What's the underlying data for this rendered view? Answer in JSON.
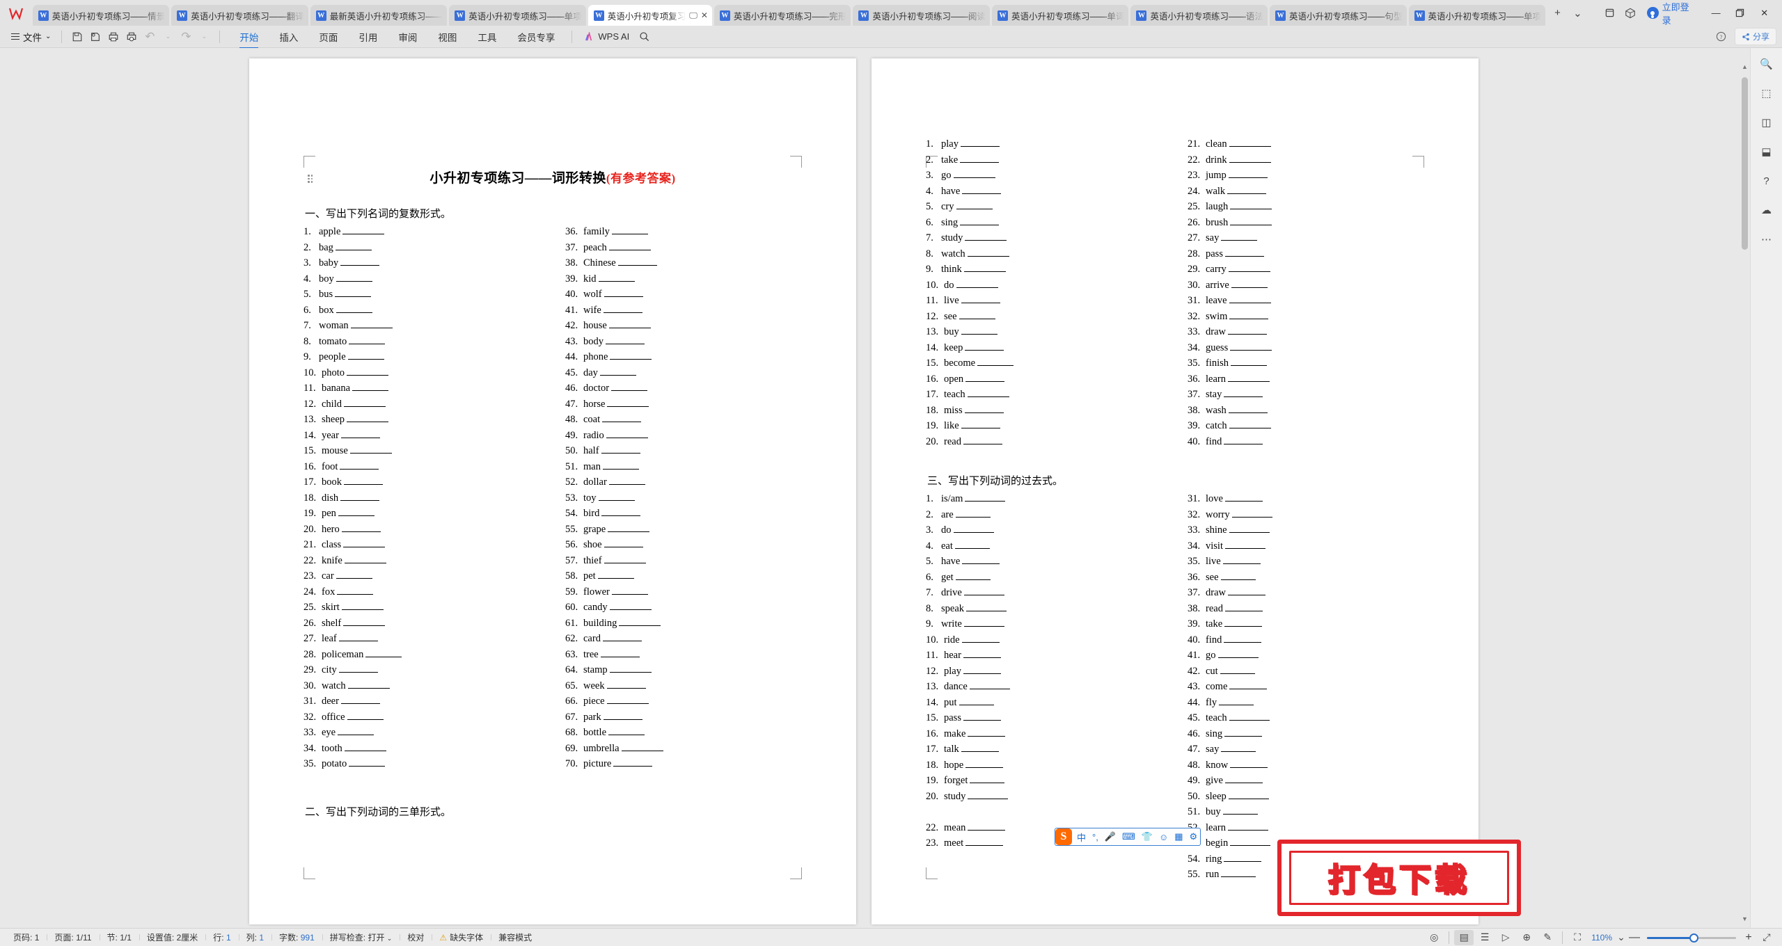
{
  "window": {
    "app_icon": "wps-logo-icon",
    "login_label": "立即登录",
    "minimize": "—",
    "restore": "❐",
    "close": "✕",
    "new_tab": "+",
    "tab_dropdown": "⌄"
  },
  "tabs": [
    {
      "label": "英语小升初专项练习——情景",
      "active": false
    },
    {
      "label": "英语小升初专项练习——翻译",
      "active": false
    },
    {
      "label": "最新英语小升初专项练习——",
      "active": false
    },
    {
      "label": "英语小升初专项练习——单项",
      "active": false
    },
    {
      "label": "英语小升初专项复习",
      "active": true
    },
    {
      "label": "英语小升初专项练习——完形",
      "active": false
    },
    {
      "label": "英语小升初专项练习——阅读",
      "active": false
    },
    {
      "label": "英语小升初专项练习——单词",
      "active": false
    },
    {
      "label": "英语小升初专项练习——语法",
      "active": false
    },
    {
      "label": "英语小升初专项练习——句型",
      "active": false
    },
    {
      "label": "英语小升初专项练习——单项",
      "active": false
    }
  ],
  "ribbon": {
    "file_label": "文件",
    "file_caret": "⌄",
    "quick_access": [
      {
        "name": "save-icon",
        "glyph": "🖫"
      },
      {
        "name": "save-as-icon",
        "glyph": "🗇"
      },
      {
        "name": "print-icon",
        "glyph": "🖨"
      },
      {
        "name": "print-preview-icon",
        "glyph": "🔍"
      },
      {
        "name": "undo-icon",
        "glyph": "↶"
      },
      {
        "name": "undo-dropdown-icon",
        "glyph": "⌄"
      },
      {
        "name": "redo-icon",
        "glyph": "↷"
      },
      {
        "name": "more-dropdown-icon",
        "glyph": "⌄"
      }
    ],
    "tabs": [
      {
        "label": "开始",
        "active": true
      },
      {
        "label": "插入",
        "active": false
      },
      {
        "label": "页面",
        "active": false
      },
      {
        "label": "引用",
        "active": false
      },
      {
        "label": "审阅",
        "active": false
      },
      {
        "label": "视图",
        "active": false
      },
      {
        "label": "工具",
        "active": false
      },
      {
        "label": "会员专享",
        "active": false
      }
    ],
    "wps_ai_label": "WPS AI",
    "search_icon": "search-icon",
    "help_icon": "help-icon",
    "share_label": "分享"
  },
  "document": {
    "title_black": "小升初专项练习——词形转换",
    "title_red": "(有参考答案)",
    "section1_heading": "一、写出下列名词的复数形式。",
    "section2_heading": "二、写出下列动词的三单形式。",
    "section3_heading": "三、写出下列动词的过去式。",
    "nouns_left": [
      "apple",
      "bag",
      "baby",
      "boy",
      "bus",
      "box",
      "woman",
      "tomato",
      "people",
      "photo",
      "banana",
      "child",
      "sheep",
      "year",
      "mouse",
      "foot",
      "book",
      "dish",
      "pen",
      "hero",
      "class",
      "knife",
      "car",
      "fox",
      "skirt",
      "shelf",
      "leaf",
      "policeman",
      "city",
      "watch",
      "deer",
      "office",
      "eye",
      "tooth",
      "potato"
    ],
    "nouns_right": [
      "family",
      "peach",
      "Chinese",
      "kid",
      "wolf",
      "wife",
      "house",
      "body",
      "phone",
      "day",
      "doctor",
      "horse",
      "coat",
      "radio",
      "half",
      "man",
      "dollar",
      "toy",
      "bird",
      "grape",
      "shoe",
      "thief",
      "pet",
      "flower",
      "candy",
      "building",
      "card",
      "tree",
      "stamp",
      "week",
      "piece",
      "park",
      "bottle",
      "umbrella",
      "picture"
    ],
    "third_person_left": [
      "play",
      "take",
      "go",
      "have",
      "cry",
      "sing",
      "study",
      "watch",
      "think",
      "do",
      "live",
      "see",
      "buy",
      "keep",
      "become",
      "open",
      "teach",
      "miss",
      "like",
      "read"
    ],
    "third_person_right": [
      "clean",
      "drink",
      "jump",
      "walk",
      "laugh",
      "brush",
      "say",
      "pass",
      "carry",
      "arrive",
      "leave",
      "swim",
      "draw",
      "guess",
      "finish",
      "learn",
      "stay",
      "wash",
      "catch",
      "find"
    ],
    "past_left": [
      "is/am",
      "are",
      "do",
      "eat",
      "have",
      "get",
      "drive",
      "speak",
      "write",
      "ride",
      "hear",
      "play",
      "dance",
      "put",
      "pass",
      "make",
      "talk",
      "hope",
      "forget",
      "study",
      "",
      "mean",
      "meet"
    ],
    "past_right": [
      "love",
      "worry",
      "shine",
      "visit",
      "live",
      "see",
      "draw",
      "read",
      "take",
      "find",
      "go",
      "cut",
      "come",
      "fly",
      "teach",
      "sing",
      "say",
      "know",
      "give",
      "sleep",
      "buy",
      "learn",
      "begin",
      "ring",
      "run"
    ]
  },
  "ime": {
    "logo": "sogou-icon",
    "items": [
      {
        "name": "chinese-mode-icon",
        "glyph": "中"
      },
      {
        "name": "punctuation-icon",
        "glyph": "°,"
      },
      {
        "name": "voice-input-icon",
        "glyph": "🎤"
      },
      {
        "name": "soft-keyboard-icon",
        "glyph": "⌨"
      },
      {
        "name": "skin-icon",
        "glyph": "👕"
      },
      {
        "name": "emoji-icon",
        "glyph": "☺"
      },
      {
        "name": "toolbox-icon",
        "glyph": "▦"
      },
      {
        "name": "settings-icon",
        "glyph": "⚙"
      }
    ]
  },
  "watermark": {
    "text": "打包下载",
    "border_color": "#e2262c",
    "text_color": "#ffe600"
  },
  "statusbar": {
    "left_items": [
      {
        "label": "页码:",
        "value": "1"
      },
      {
        "label": "页面:",
        "value": "1/11"
      },
      {
        "label": "节:",
        "value": "1/1"
      },
      {
        "label": "设置值:",
        "value": "2厘米"
      },
      {
        "label": "行:",
        "value": "1"
      },
      {
        "label": "列:",
        "value": "1"
      },
      {
        "label": "字数:",
        "value": "991"
      },
      {
        "label": "拼写检查:",
        "value": "打开"
      },
      {
        "label": "校对",
        "value": ""
      },
      {
        "label": "缺失字体",
        "value": ""
      },
      {
        "label": "兼容模式",
        "value": ""
      }
    ],
    "view_icons": [
      {
        "name": "eye-icon",
        "glyph": "◎"
      },
      {
        "name": "page-layout-view-icon",
        "glyph": "▤"
      },
      {
        "name": "outline-view-icon",
        "glyph": "☰"
      },
      {
        "name": "reading-view-icon",
        "glyph": "▷"
      },
      {
        "name": "web-view-icon",
        "glyph": "⊕"
      },
      {
        "name": "markup-icon",
        "glyph": "✎"
      },
      {
        "name": "fit-page-icon",
        "glyph": "⛶"
      }
    ],
    "zoom_value": "110%",
    "zoom_caret": "⌄",
    "zoom_out": "—",
    "zoom_in": "+",
    "fullscreen_icon": "⤢"
  },
  "rail_icons": [
    {
      "name": "search-panel-icon",
      "glyph": "🔍"
    },
    {
      "name": "selection-pane-icon",
      "glyph": "⬚"
    },
    {
      "name": "shapes-icon",
      "glyph": "◫"
    },
    {
      "name": "format-icon",
      "glyph": "⬓"
    },
    {
      "name": "help-panel-icon",
      "glyph": "?"
    },
    {
      "name": "feedback-icon",
      "glyph": "☁"
    },
    {
      "name": "more-panel-icon",
      "glyph": "⋯"
    }
  ]
}
